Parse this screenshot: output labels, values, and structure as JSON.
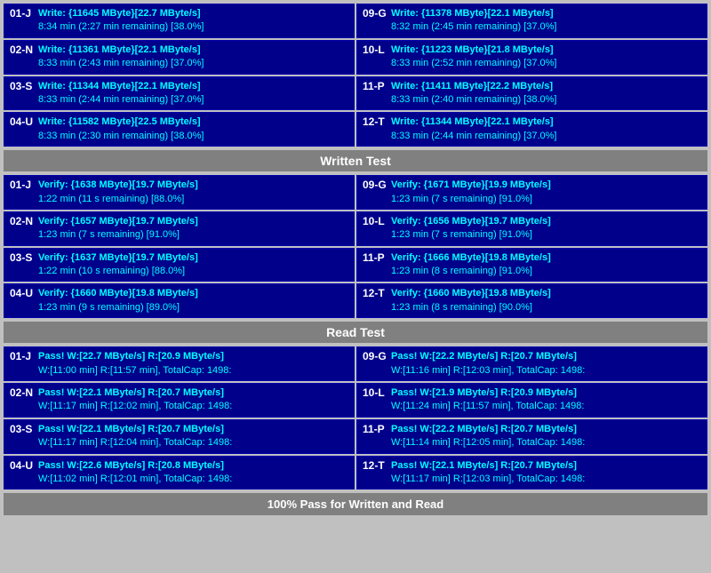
{
  "sections": {
    "write": {
      "rows_left": [
        {
          "id": "01-J",
          "line1": "Write: {11645 MByte}[22.7 MByte/s]",
          "line2": "8:34 min (2:27 min remaining)  [38.0%]"
        },
        {
          "id": "02-N",
          "line1": "Write: {11361 MByte}[22.1 MByte/s]",
          "line2": "8:33 min (2:43 min remaining)  [37.0%]"
        },
        {
          "id": "03-S",
          "line1": "Write: {11344 MByte}[22.1 MByte/s]",
          "line2": "8:33 min (2:44 min remaining)  [37.0%]"
        },
        {
          "id": "04-U",
          "line1": "Write: {11582 MByte}[22.5 MByte/s]",
          "line2": "8:33 min (2:30 min remaining)  [38.0%]"
        }
      ],
      "rows_right": [
        {
          "id": "09-G",
          "line1": "Write: {11378 MByte}[22.1 MByte/s]",
          "line2": "8:32 min (2:45 min remaining)  [37.0%]"
        },
        {
          "id": "10-L",
          "line1": "Write: {11223 MByte}[21.8 MByte/s]",
          "line2": "8:33 min (2:52 min remaining)  [37.0%]"
        },
        {
          "id": "11-P",
          "line1": "Write: {11411 MByte}[22.2 MByte/s]",
          "line2": "8:33 min (2:40 min remaining)  [38.0%]"
        },
        {
          "id": "12-T",
          "line1": "Write: {11344 MByte}[22.1 MByte/s]",
          "line2": "8:33 min (2:44 min remaining)  [37.0%]"
        }
      ],
      "header": "Written Test"
    },
    "verify": {
      "rows_left": [
        {
          "id": "01-J",
          "line1": "Verify: {1638 MByte}[19.7 MByte/s]",
          "line2": "1:22 min (11 s remaining)   [88.0%]"
        },
        {
          "id": "02-N",
          "line1": "Verify: {1657 MByte}[19.7 MByte/s]",
          "line2": "1:23 min (7 s remaining)   [91.0%]"
        },
        {
          "id": "03-S",
          "line1": "Verify: {1637 MByte}[19.7 MByte/s]",
          "line2": "1:22 min (10 s remaining)   [88.0%]"
        },
        {
          "id": "04-U",
          "line1": "Verify: {1660 MByte}[19.8 MByte/s]",
          "line2": "1:23 min (9 s remaining)   [89.0%]"
        }
      ],
      "rows_right": [
        {
          "id": "09-G",
          "line1": "Verify: {1671 MByte}[19.9 MByte/s]",
          "line2": "1:23 min (7 s remaining)   [91.0%]"
        },
        {
          "id": "10-L",
          "line1": "Verify: {1656 MByte}[19.7 MByte/s]",
          "line2": "1:23 min (7 s remaining)   [91.0%]"
        },
        {
          "id": "11-P",
          "line1": "Verify: {1666 MByte}[19.8 MByte/s]",
          "line2": "1:23 min (8 s remaining)   [91.0%]"
        },
        {
          "id": "12-T",
          "line1": "Verify: {1660 MByte}[19.8 MByte/s]",
          "line2": "1:23 min (8 s remaining)   [90.0%]"
        }
      ]
    },
    "read": {
      "header": "Read Test",
      "rows_left": [
        {
          "id": "01-J",
          "line1": "Pass! W:[22.7 MByte/s] R:[20.9 MByte/s]",
          "line2": "W:[11:00 min] R:[11:57 min], TotalCap: 1498:"
        },
        {
          "id": "02-N",
          "line1": "Pass! W:[22.1 MByte/s] R:[20.7 MByte/s]",
          "line2": "W:[11:17 min] R:[12:02 min], TotalCap: 1498:"
        },
        {
          "id": "03-S",
          "line1": "Pass! W:[22.1 MByte/s] R:[20.7 MByte/s]",
          "line2": "W:[11:17 min] R:[12:04 min], TotalCap: 1498:"
        },
        {
          "id": "04-U",
          "line1": "Pass! W:[22.6 MByte/s] R:[20.8 MByte/s]",
          "line2": "W:[11:02 min] R:[12:01 min], TotalCap: 1498:"
        }
      ],
      "rows_right": [
        {
          "id": "09-G",
          "line1": "Pass! W:[22.2 MByte/s] R:[20.7 MByte/s]",
          "line2": "W:[11:16 min] R:[12:03 min], TotalCap: 1498:"
        },
        {
          "id": "10-L",
          "line1": "Pass! W:[21.9 MByte/s] R:[20.9 MByte/s]",
          "line2": "W:[11:24 min] R:[11:57 min], TotalCap: 1498:"
        },
        {
          "id": "11-P",
          "line1": "Pass! W:[22.2 MByte/s] R:[20.7 MByte/s]",
          "line2": "W:[11:14 min] R:[12:05 min], TotalCap: 1498:"
        },
        {
          "id": "12-T",
          "line1": "Pass! W:[22.1 MByte/s] R:[20.7 MByte/s]",
          "line2": "W:[11:17 min] R:[12:03 min], TotalCap: 1498:"
        }
      ]
    }
  },
  "footer": "100% Pass for Written and Read"
}
